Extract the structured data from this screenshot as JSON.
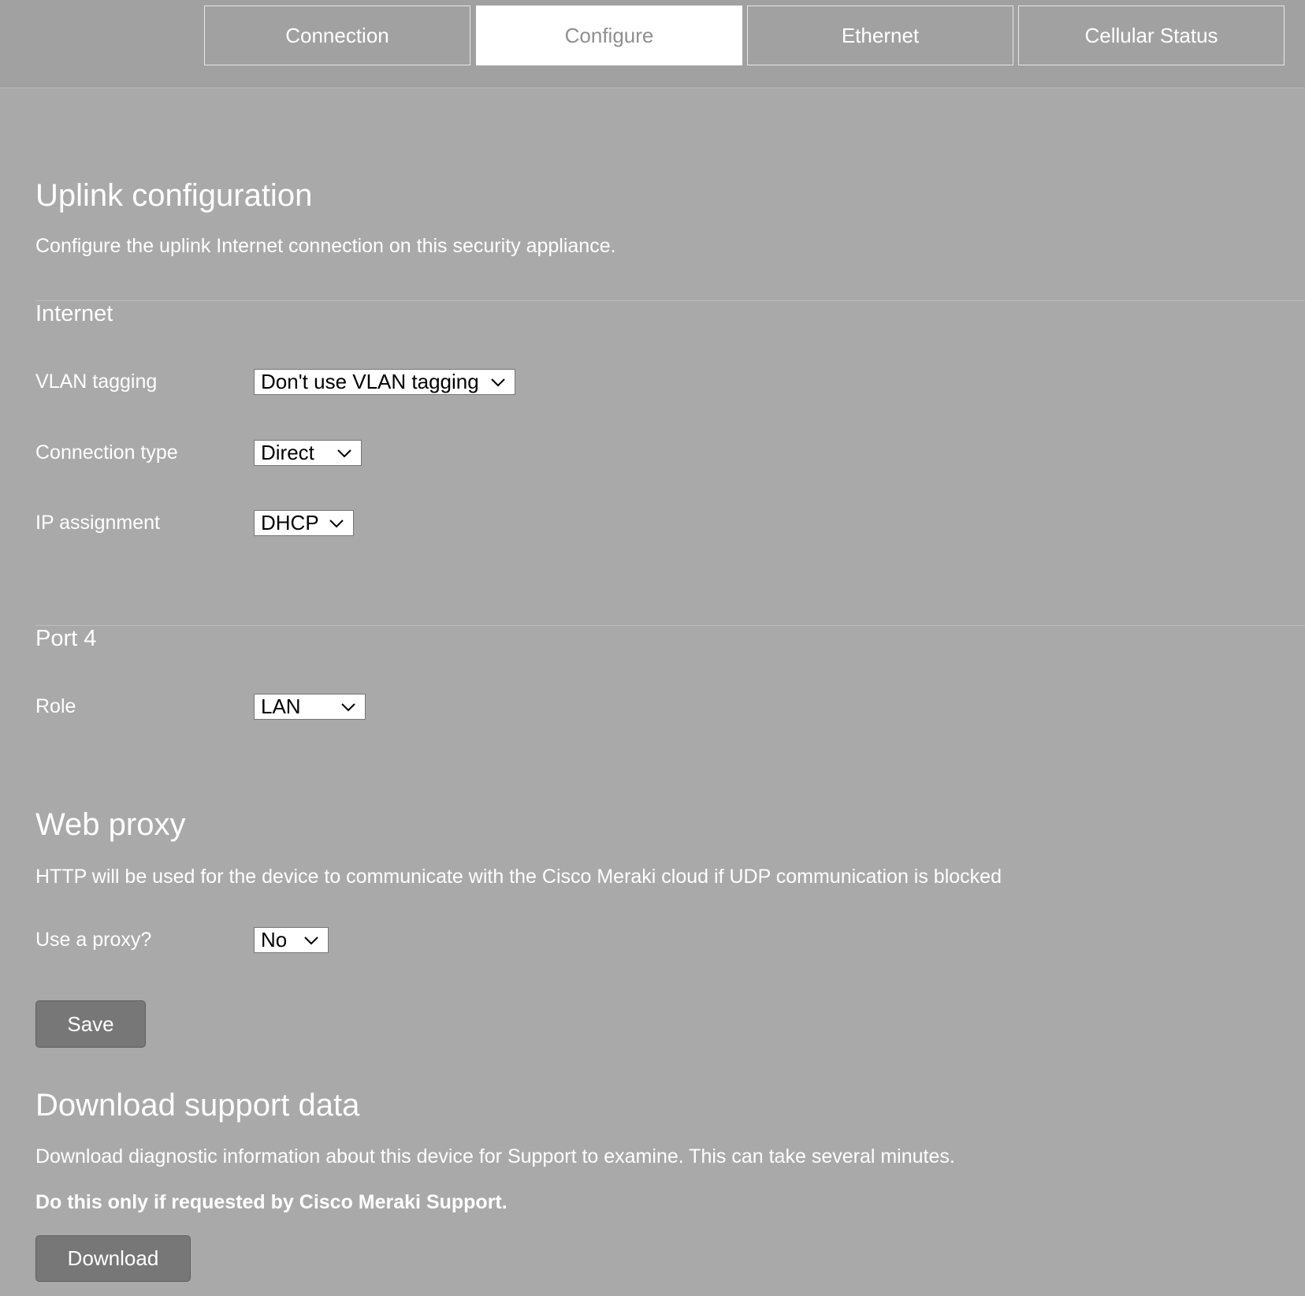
{
  "tabs": [
    {
      "label": "Connection",
      "active": false
    },
    {
      "label": "Configure",
      "active": true
    },
    {
      "label": "Ethernet",
      "active": false
    },
    {
      "label": "Cellular Status",
      "active": false
    }
  ],
  "uplink": {
    "title": "Uplink configuration",
    "description": "Configure the uplink Internet connection on this security appliance."
  },
  "internet": {
    "heading": "Internet",
    "vlan_tagging": {
      "label": "VLAN tagging",
      "value": "Don't use VLAN tagging"
    },
    "connection_type": {
      "label": "Connection type",
      "value": "Direct"
    },
    "ip_assignment": {
      "label": "IP assignment",
      "value": "DHCP"
    }
  },
  "port4": {
    "heading": "Port 4",
    "role": {
      "label": "Role",
      "value": "LAN"
    }
  },
  "web_proxy": {
    "title": "Web proxy",
    "description": "HTTP will be used for the device to communicate with the Cisco Meraki cloud if UDP communication is blocked",
    "use_proxy": {
      "label": "Use a proxy?",
      "value": "No"
    },
    "save_label": "Save"
  },
  "support": {
    "title": "Download support data",
    "description": "Download diagnostic information about this device for Support to examine. This can take several minutes.",
    "warning": "Do this only if requested by Cisco Meraki Support.",
    "download_label": "Download"
  },
  "icons": {
    "dropdown": "chevron-down-icon"
  },
  "colors": {
    "page_background": "#a9a9a9",
    "active_tab_background": "#ffffff",
    "active_tab_text": "#8f8f8f",
    "button_background": "#777777"
  }
}
